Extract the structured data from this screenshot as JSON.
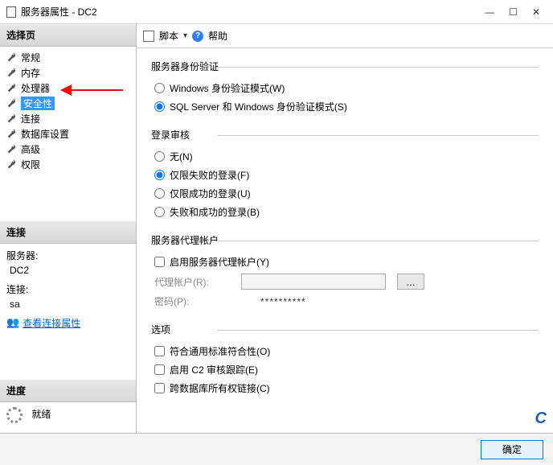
{
  "window": {
    "title": "服务器属性 - DC2",
    "min": "—",
    "max": "☐",
    "close": "✕"
  },
  "sidebar": {
    "header_select": "选择页",
    "items": [
      {
        "label": "常规"
      },
      {
        "label": "内存"
      },
      {
        "label": "处理器"
      },
      {
        "label": "安全性"
      },
      {
        "label": "连接"
      },
      {
        "label": "数据库设置"
      },
      {
        "label": "高级"
      },
      {
        "label": "权限"
      }
    ],
    "header_conn": "连接",
    "server_label": "服务器:",
    "server_val": "DC2",
    "conn_label": "连接:",
    "conn_val": "sa",
    "conn_link": "查看连接属性",
    "header_prog": "进度",
    "prog_status": "就绪"
  },
  "topbar": {
    "script": "脚本",
    "help": "帮助"
  },
  "auth": {
    "title": "服务器身份验证",
    "opt_windows": "Windows 身份验证模式(W)",
    "opt_mixed": "SQL Server 和 Windows 身份验证模式(S)"
  },
  "audit": {
    "title": "登录审核",
    "opt_none": "无(N)",
    "opt_failed": "仅限失败的登录(F)",
    "opt_success": "仅限成功的登录(U)",
    "opt_both": "失败和成功的登录(B)"
  },
  "proxy": {
    "title": "服务器代理帐户",
    "enable": "启用服务器代理帐户(Y)",
    "acct_label": "代理帐户(R):",
    "pwd_label": "密码(P):",
    "pwd_val": "**********",
    "browse": "..."
  },
  "options": {
    "title": "选项",
    "cc": "符合通用标准符合性(O)",
    "c2": "启用 C2 审核跟踪(E)",
    "chain": "跨数据库所有权链接(C)"
  },
  "footer": {
    "ok": "确定"
  },
  "brand": "C"
}
